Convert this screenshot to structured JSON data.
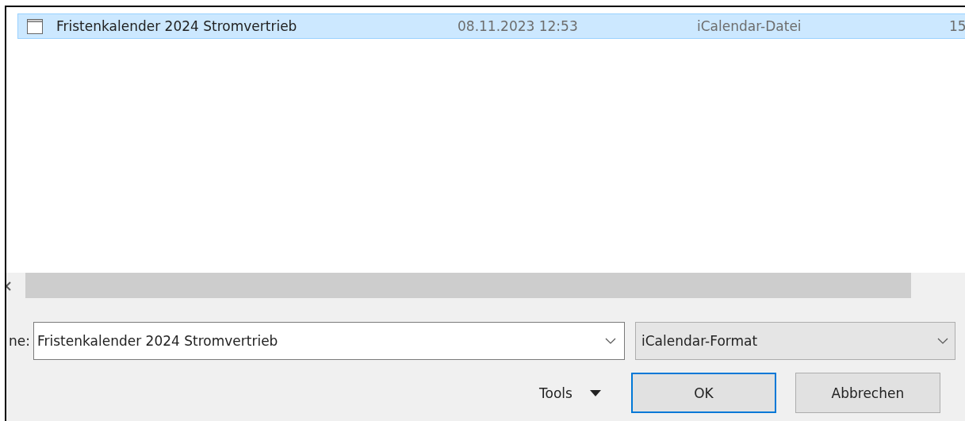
{
  "file_list": {
    "rows": [
      {
        "name": "Fristenkalender 2024 Stromvertrieb",
        "modified": "08.11.2023 12:53",
        "type": "iCalendar-Datei",
        "column_4": "15",
        "selected": true
      }
    ]
  },
  "filename": {
    "label": "ne:",
    "value": "Fristenkalender 2024 Stromvertrieb"
  },
  "file_type": {
    "value": "iCalendar-Format"
  },
  "tools": {
    "label": "Tools"
  },
  "buttons": [
    {
      "label": "OK",
      "kind": "default"
    },
    {
      "label": "Abbrechen",
      "kind": "normal"
    }
  ]
}
